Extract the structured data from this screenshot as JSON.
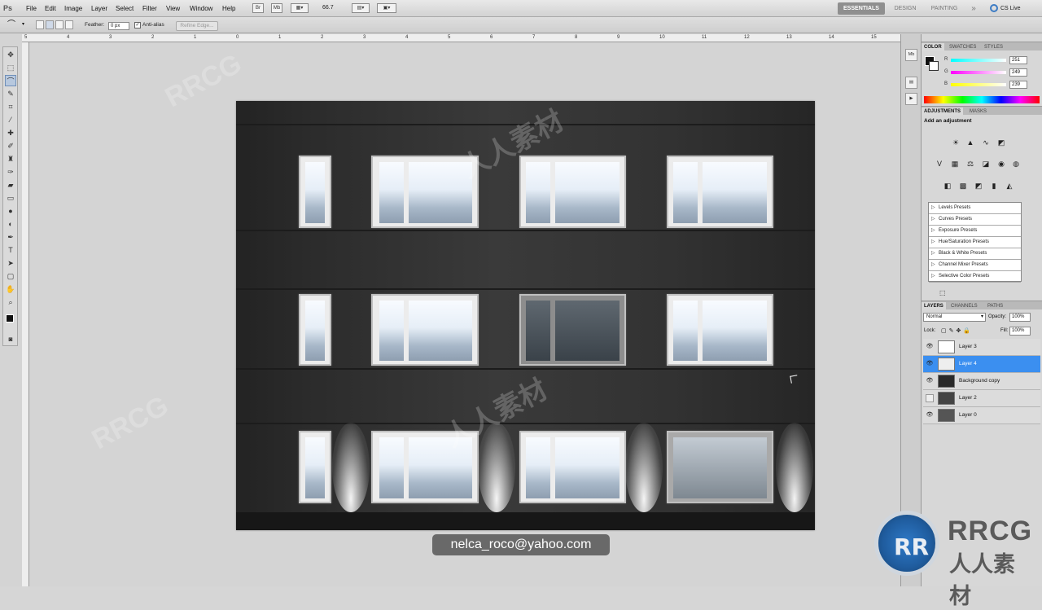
{
  "app": {
    "logo": "Ps"
  },
  "menu": [
    "File",
    "Edit",
    "Image",
    "Layer",
    "Select",
    "Filter",
    "View",
    "Window",
    "Help"
  ],
  "menubar": {
    "zoom": "66.7",
    "workspaces": [
      "ESSENTIALS",
      "DESIGN",
      "PAINTING"
    ],
    "more": "»",
    "cslive": "CS Live"
  },
  "options": {
    "feather_label": "Feather:",
    "feather_value": "0 px",
    "antialias_label": "Anti-alias",
    "refine_edge": "Refine Edge..."
  },
  "ruler": {
    "top_marks": [
      "5",
      "4",
      "3",
      "2",
      "1",
      "0",
      "1",
      "2",
      "3",
      "4",
      "5",
      "6",
      "7",
      "8",
      "9",
      "10",
      "11",
      "12",
      "13",
      "14",
      "15"
    ]
  },
  "tools": [
    "move-tool",
    "marquee-tool",
    "lasso-tool",
    "quick-select-tool",
    "crop-tool",
    "eyedropper-tool",
    "spot-heal-tool",
    "brush-tool",
    "clone-stamp-tool",
    "history-brush-tool",
    "eraser-tool",
    "gradient-tool",
    "blur-tool",
    "dodge-tool",
    "pen-tool",
    "type-tool",
    "path-select-tool",
    "shape-tool",
    "hand-tool",
    "zoom-tool"
  ],
  "caption": "nelca_roco@yahoo.com",
  "color_panel": {
    "tabs": [
      "COLOR",
      "SWATCHES",
      "STYLES"
    ],
    "r_label": "R",
    "g_label": "G",
    "b_label": "B",
    "r": "251",
    "g": "249",
    "b": "239"
  },
  "adjustments_panel": {
    "tabs": [
      "ADJUSTMENTS",
      "MASKS"
    ],
    "title": "Add an adjustment",
    "presets": [
      "Levels Presets",
      "Curves Presets",
      "Exposure Presets",
      "Hue/Saturation Presets",
      "Black & White Presets",
      "Channel Mixer Presets",
      "Selective Color Presets"
    ]
  },
  "layers_panel": {
    "tabs": [
      "LAYERS",
      "CHANNELS",
      "PATHS"
    ],
    "blend_mode": "Normal",
    "opacity_label": "Opacity:",
    "opacity": "100%",
    "lock_label": "Lock:",
    "fill_label": "Fill:",
    "fill": "100%",
    "layers": [
      "Layer 3",
      "Layer 4",
      "Background copy",
      "Layer 2",
      "Layer 0"
    ],
    "selected": "Layer 4"
  },
  "watermark": {
    "letters": "RR",
    "brand": "RRCG",
    "subtitle": "人人素材",
    "overlay": [
      "RRCG",
      "人人素材"
    ]
  },
  "colors": {
    "selected_layer": "#3b8ff0",
    "canvas_wall": "#2f2f2f",
    "window_glass": "#e6eef7",
    "caption_bg": "#5a5a5a"
  }
}
